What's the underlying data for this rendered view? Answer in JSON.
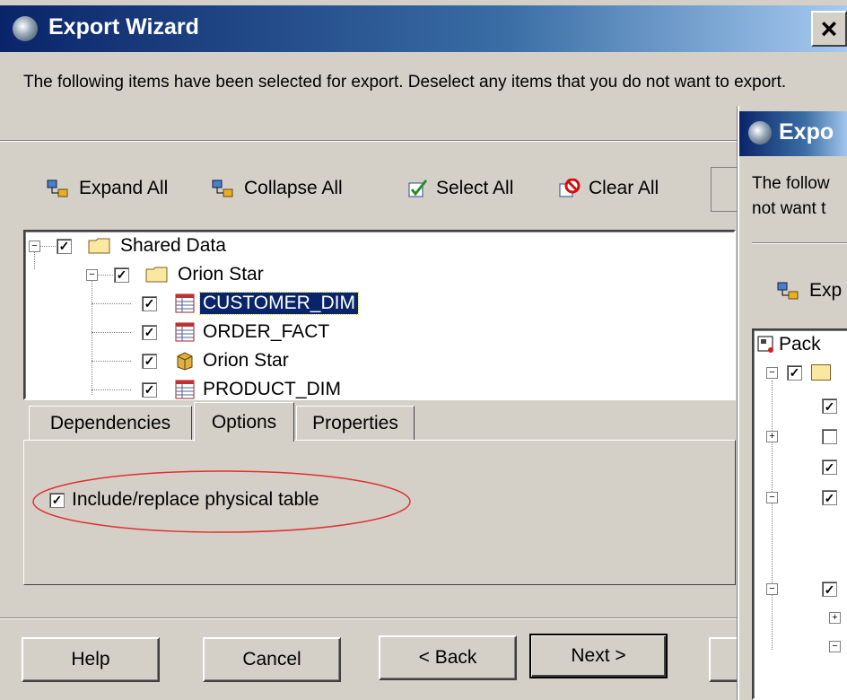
{
  "main_window": {
    "title": "Export Wizard",
    "close_glyph": "×",
    "instructions": "The following items have been selected for export.  Deselect any items that you do not want to export.",
    "toolbar": {
      "expand_all": "Expand All",
      "collapse_all": "Collapse All",
      "select_all": "Select All",
      "clear_all": "Clear All"
    },
    "tree": [
      {
        "label": "Shared Data",
        "icon": "folder-icon",
        "checked": true,
        "selected": false
      },
      {
        "label": "Orion Star",
        "icon": "folder-icon",
        "checked": true,
        "selected": false
      },
      {
        "label": "CUSTOMER_DIM",
        "icon": "table-icon",
        "checked": true,
        "selected": true
      },
      {
        "label": "ORDER_FACT",
        "icon": "table-icon",
        "checked": true,
        "selected": false
      },
      {
        "label": "Orion Star",
        "icon": "library-icon",
        "checked": true,
        "selected": false
      },
      {
        "label": "PRODUCT_DIM",
        "icon": "table-icon",
        "checked": true,
        "selected": false
      }
    ],
    "tabs": {
      "dependencies": "Dependencies",
      "options": "Options",
      "properties": "Properties"
    },
    "option_checkbox_label": "Include/replace physical table",
    "buttons": {
      "help": "Help",
      "cancel": "Cancel",
      "back": "< Back",
      "next": "Next >"
    },
    "annotation_color": "#e03030"
  },
  "second_window": {
    "title": "Expo",
    "instructions_line1": "The follow",
    "instructions_line2": "not want t",
    "toolbar_expand": "Exp",
    "tree_root": "Pack"
  }
}
